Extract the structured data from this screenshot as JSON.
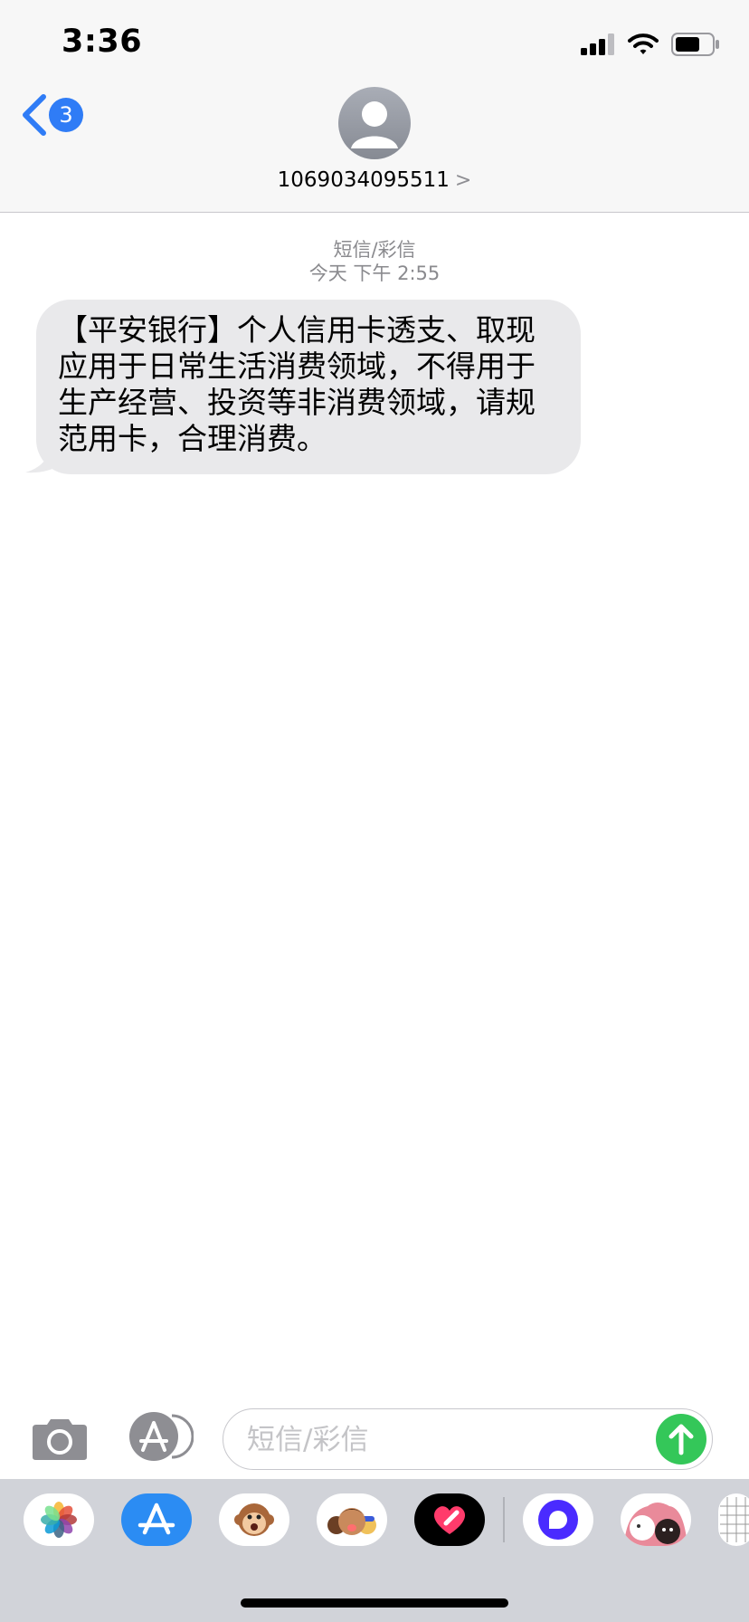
{
  "status_bar": {
    "time": "3:36"
  },
  "nav": {
    "back_badge": "3",
    "contact_number": "1069034095511",
    "contact_chevron": ">"
  },
  "thread": {
    "service_label": "短信/彩信",
    "timestamp": "今天 下午 2:55",
    "messages": [
      {
        "direction": "incoming",
        "lines": [
          "【平安银行】个人信用卡透支、取现",
          "应用于日常生活消费领域，不得用于",
          "生产经营、投资等非消费领域，请规",
          "范用卡，合理消费。"
        ]
      }
    ]
  },
  "compose": {
    "placeholder": "短信/彩信"
  },
  "app_drawer": {
    "apps": [
      "photos-icon",
      "app-store-icon",
      "animoji-monkey-icon",
      "memoji-icon",
      "digital-touch-icon",
      "circle-app-icon",
      "sticker-app-icon",
      "grid-app-icon"
    ]
  },
  "colors": {
    "accent": "#2f7cf6",
    "send": "#34c759",
    "incoming_bubble": "#e9e9eb",
    "header_bg": "#f7f7f7",
    "drawer_bg": "#d1d3d9"
  }
}
